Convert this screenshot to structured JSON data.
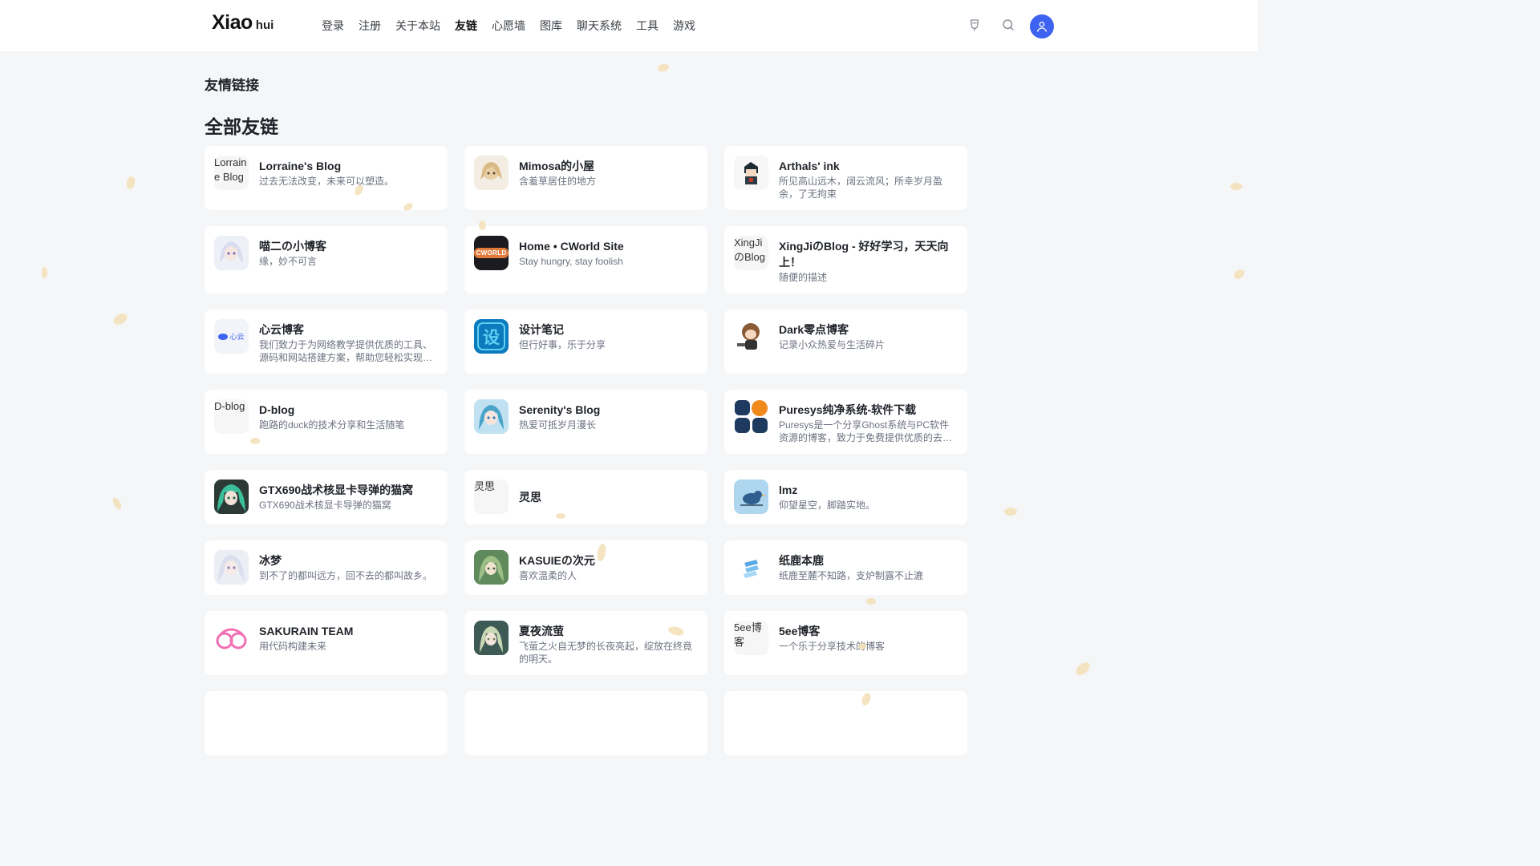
{
  "header": {
    "logo_main": "Xiao",
    "logo_sub": "hui",
    "nav": [
      "登录",
      "注册",
      "关于本站",
      "友链",
      "心愿墙",
      "图库",
      "聊天系统",
      "工具",
      "游戏"
    ],
    "active_nav": "友链"
  },
  "page": {
    "breadcrumb": "友情链接",
    "section_title": "全部友链"
  },
  "links": [
    {
      "name": "Lorraine's Blog",
      "desc": "过去无法改变，未来可以塑造。",
      "icon_alt": "Lorraine Blog"
    },
    {
      "name": "Mimosa的小屋",
      "desc": "含羞草居住的地方"
    },
    {
      "name": "Arthals' ink",
      "desc": "所见高山远木，阔云流风；所幸岁月盈余，了无拘束"
    },
    {
      "name": "喵二の小博客",
      "desc": "缘，妙不可言"
    },
    {
      "name": "Home • CWorld Site",
      "desc": "Stay hungry, stay foolish",
      "icon_text": "CWORLD"
    },
    {
      "name": "XingJiのBlog - 好好学习，天天向上！",
      "desc": "随便的描述",
      "icon_alt": "XingJiのBlog"
    },
    {
      "name": "心云博客",
      "desc": "我们致力于为网络教学提供优质的工具、源码和网站搭建方案，帮助您轻松实现教学...",
      "icon_text": "心云"
    },
    {
      "name": "设计笔记",
      "desc": "但行好事，乐于分享",
      "icon_text": "设"
    },
    {
      "name": "Dark零点博客",
      "desc": "记录小众热爱与生活碎片"
    },
    {
      "name": "D-blog",
      "desc": "跑路的duck的技术分享和生活随笔",
      "icon_alt": "D-blog"
    },
    {
      "name": "Serenity's Blog",
      "desc": "热爱可抵岁月漫长"
    },
    {
      "name": "Puresys纯净系统-软件下载",
      "desc": "Puresys是一个分享Ghost系统与PC软件资源的博客，致力于免费提供优质的去广告..."
    },
    {
      "name": "GTX690战术核显卡导弹的猫窝",
      "desc": "GTX690战术核显卡导弹的猫窝"
    },
    {
      "name": "灵思",
      "desc": "",
      "icon_alt": "灵思"
    },
    {
      "name": "lmz",
      "desc": "仰望星空，脚踏实地。"
    },
    {
      "name": "冰梦",
      "desc": "到不了的都叫远方，回不去的都叫故乡。"
    },
    {
      "name": "KASUIEの次元",
      "desc": "喜欢温柔的人"
    },
    {
      "name": "纸鹿本鹿",
      "desc": "纸鹿至麓不知路，支炉制露不止漉"
    },
    {
      "name": "SAKURAIN TEAM",
      "desc": "用代码构建未来"
    },
    {
      "name": "夏夜流萤",
      "desc": "飞萤之火自无梦的长夜亮起，绽放在终竟的明天。"
    },
    {
      "name": "5ee博客",
      "desc": "一个乐于分享技术的博客",
      "icon_alt": "5ee博客"
    }
  ],
  "colors": {
    "accent": "#3d63f0",
    "page_bg": "#f5f6f8",
    "petal": "#f3dfb6"
  }
}
